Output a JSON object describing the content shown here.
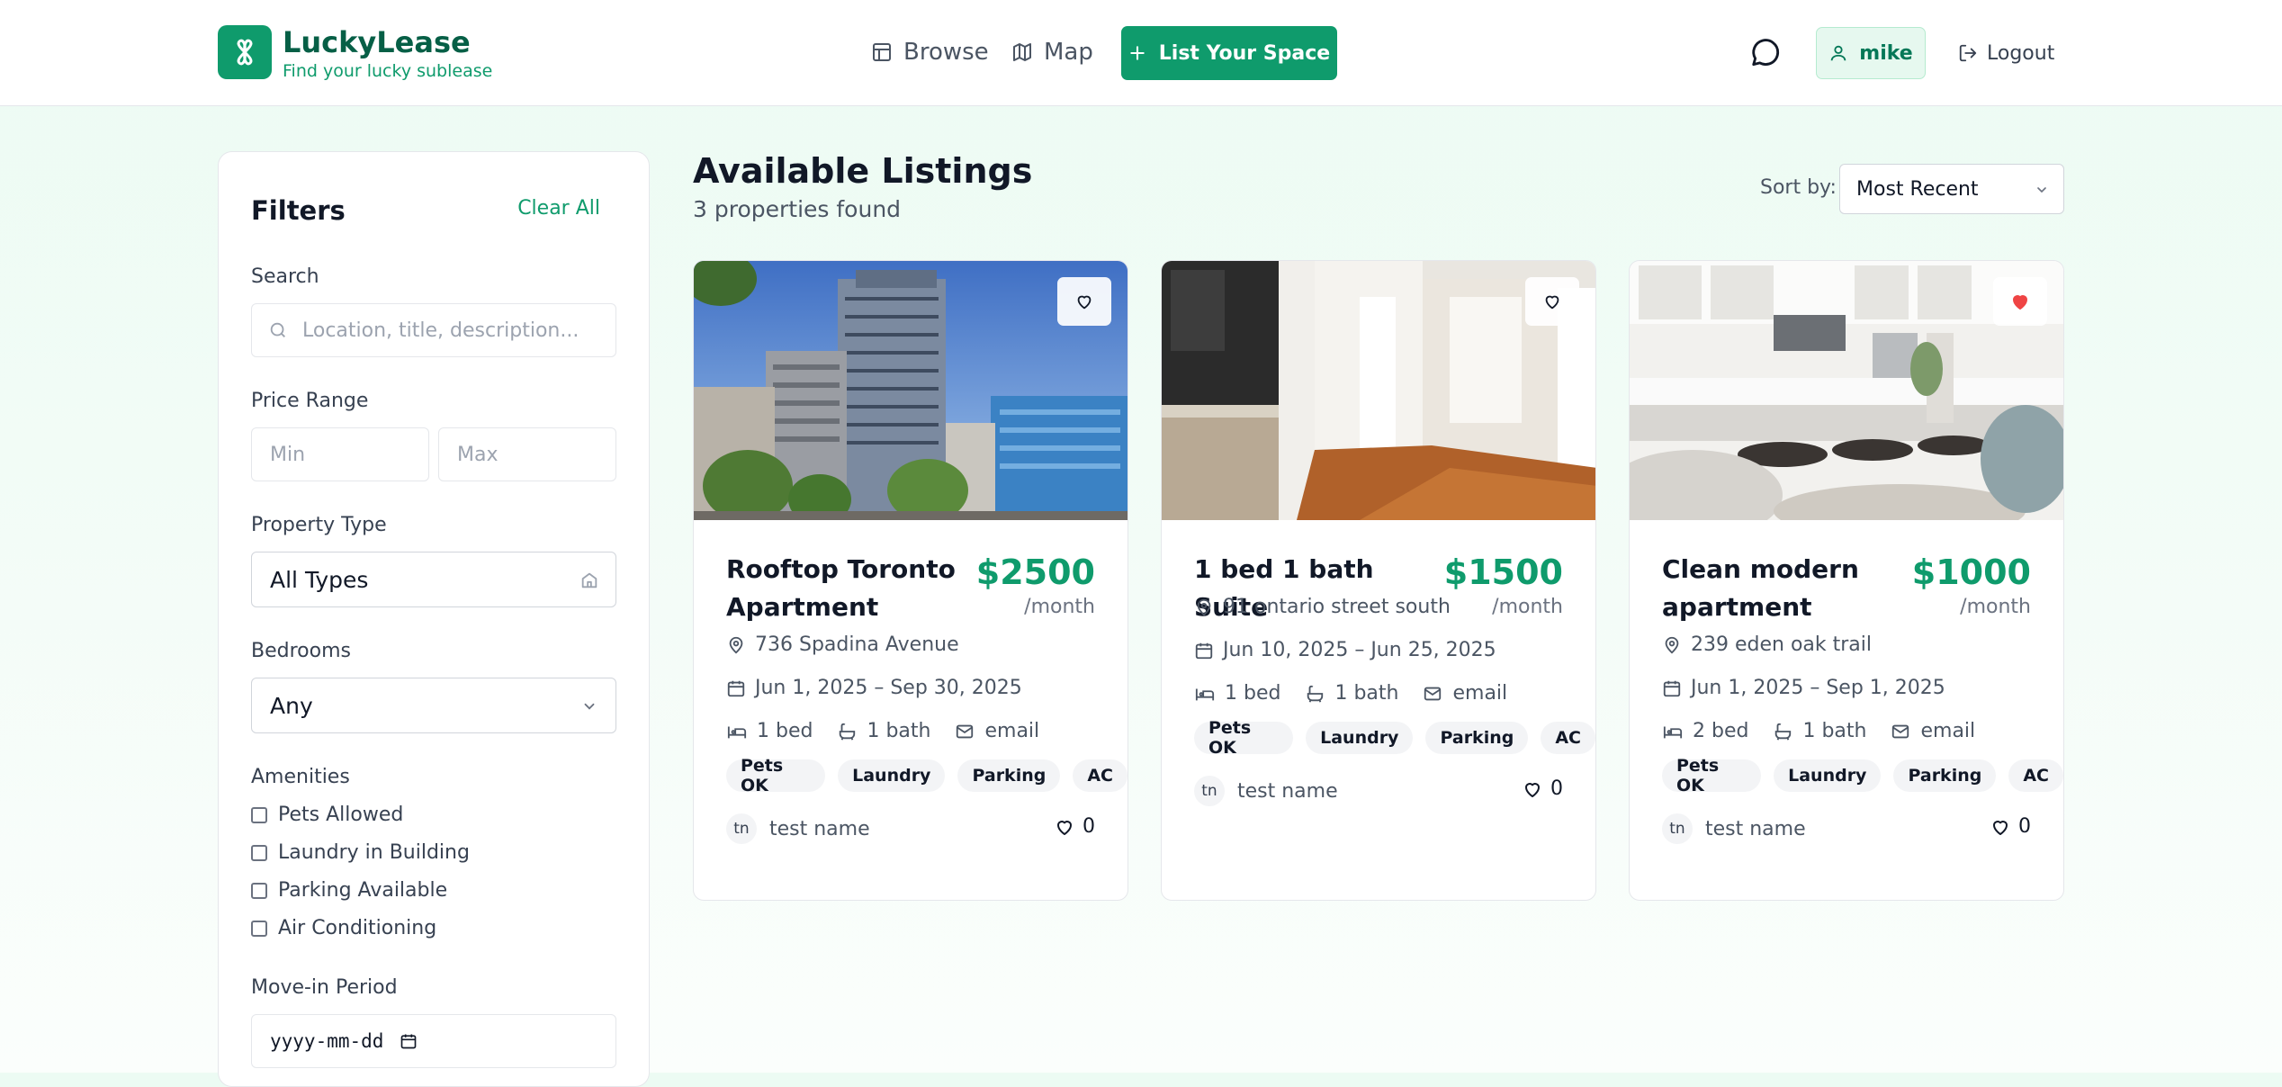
{
  "brand": {
    "name": "LuckyLease",
    "tagline": "Find your lucky sublease"
  },
  "nav": {
    "browse": "Browse",
    "map": "Map",
    "list_space": "List Your Space",
    "user": "mike",
    "logout": "Logout"
  },
  "filters": {
    "title": "Filters",
    "clear": "Clear All",
    "search_label": "Search",
    "search_placeholder": "Location, title, description...",
    "price_label": "Price Range",
    "price_min_placeholder": "Min",
    "price_max_placeholder": "Max",
    "type_label": "Property Type",
    "type_value": "All Types",
    "bedrooms_label": "Bedrooms",
    "bedrooms_value": "Any",
    "amenities_label": "Amenities",
    "amenities": [
      "Pets Allowed",
      "Laundry in Building",
      "Parking Available",
      "Air Conditioning"
    ],
    "movein_label": "Move-in Period",
    "movein_placeholder": "yyyy-mm-dd"
  },
  "main": {
    "title": "Available Listings",
    "count": "3 properties found",
    "sort_label": "Sort by:",
    "sort_value": "Most Recent"
  },
  "listings": [
    {
      "title": "Rooftop Toronto Apartment",
      "price": "$2500",
      "per": "/month",
      "address": "736 Spadina Avenue",
      "dates": "Jun 1, 2025 – Sep 30, 2025",
      "beds": "1 bed",
      "baths": "1 bath",
      "contact": "email",
      "tags": [
        "Pets OK",
        "Laundry",
        "Parking",
        "AC"
      ],
      "host_initials": "tn",
      "host": "test name",
      "likes": "0",
      "favorited": false
    },
    {
      "title": "1 bed 1 bath Suite",
      "price": "$1500",
      "per": "/month",
      "address": "91 ontario street south",
      "dates": "Jun 10, 2025 – Jun 25, 2025",
      "beds": "1 bed",
      "baths": "1 bath",
      "contact": "email",
      "tags": [
        "Pets OK",
        "Laundry",
        "Parking",
        "AC"
      ],
      "host_initials": "tn",
      "host": "test name",
      "likes": "0",
      "favorited": false
    },
    {
      "title": "Clean modern apartment",
      "price": "$1000",
      "per": "/month",
      "address": "239 eden oak trail",
      "dates": "Jun 1, 2025 – Sep 1, 2025",
      "beds": "2 bed",
      "baths": "1 bath",
      "contact": "email",
      "tags": [
        "Pets OK",
        "Laundry",
        "Parking",
        "AC"
      ],
      "host_initials": "tn",
      "host": "test name",
      "likes": "0",
      "favorited": true
    }
  ],
  "colors": {
    "brand": "#0f9b6c",
    "heart_active": "#ef4444"
  }
}
